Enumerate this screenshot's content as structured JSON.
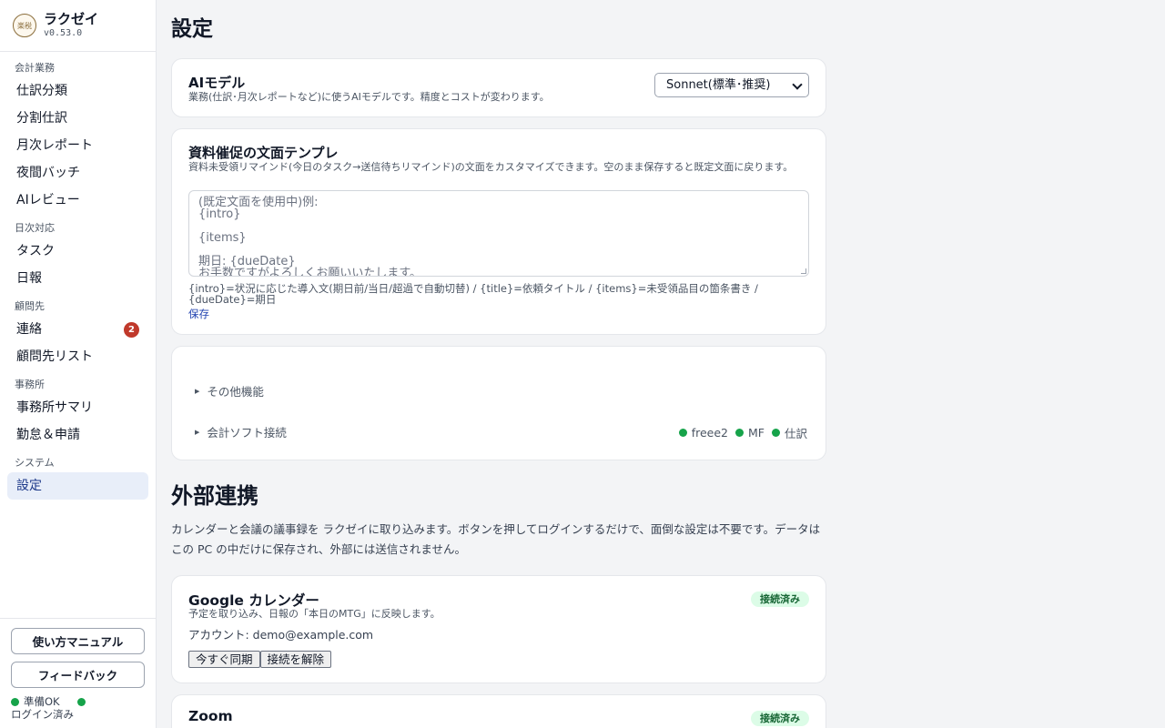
{
  "app": {
    "name": "ラクゼイ",
    "version": "v0.53.0",
    "logo_text": "楽税"
  },
  "sidebar": {
    "sections": [
      {
        "label": "会計業務",
        "items": [
          {
            "label": "仕訳分類"
          },
          {
            "label": "分割仕訳"
          },
          {
            "label": "月次レポート"
          },
          {
            "label": "夜間バッチ"
          },
          {
            "label": "AIレビュー"
          }
        ]
      },
      {
        "label": "日次対応",
        "items": [
          {
            "label": "タスク"
          },
          {
            "label": "日報"
          }
        ]
      },
      {
        "label": "顧問先",
        "items": [
          {
            "label": "連絡",
            "badge": "2"
          },
          {
            "label": "顧問先リスト"
          }
        ]
      },
      {
        "label": "事務所",
        "items": [
          {
            "label": "事務所サマリ"
          },
          {
            "label": "勤怠＆申請"
          }
        ]
      },
      {
        "label": "システム",
        "items": [
          {
            "label": "設定",
            "active": true
          }
        ]
      }
    ],
    "footer": {
      "manual_button": "使い方マニュアル",
      "feedback_button": "フィードバック",
      "status_text": "準備OK",
      "login_text": "ログイン済み"
    }
  },
  "page": {
    "title": "設定"
  },
  "ai_model": {
    "title": "AIモデル",
    "description": "業務(仕訳･月次レポートなど)に使うAIモデルです。精度とコストが変わります。",
    "selected": "Sonnet(標準･推奨)"
  },
  "template": {
    "title": "資料催促の文面テンプレ",
    "description": "資料未受領リマインド(今日のタスク→送信待ちリマインド)の文面をカスタマイズできます。空のまま保存すると既定文面に戻ります。",
    "placeholder_lines": [
      "(既定文面を使用中)例:",
      "{intro}",
      "",
      "{items}",
      "",
      "期日: {dueDate}",
      "お手数ですがよろしくお願いいたします。"
    ],
    "help": "{intro}=状況に応じた導入文(期日前/当日/超過で自動切替) / {title}=依頼タイトル / {items}=未受領品目の箇条書き / {dueDate}=期日",
    "save_label": "保存"
  },
  "misc": {
    "other_features": "その他機能",
    "accounting_software": "会計ソフト接続",
    "connections": [
      "freee2",
      "MF",
      "仕訳"
    ]
  },
  "integrations": {
    "title": "外部連携",
    "description": "カレンダーと会議の議事録を ラクゼイに取り込みます。ボタンを押してログインするだけで、面倒な設定は不要です。データはこの PC の中だけに保存され、外部には送信されません。",
    "google": {
      "title": "Google カレンダー",
      "status": "接続済み",
      "description": "予定を取り込み、日報の「本日のMTG」に反映します。",
      "account": "アカウント: demo@example.com",
      "sync_button": "今すぐ同期",
      "disconnect_button": "接続を解除"
    },
    "zoom": {
      "title": "Zoom",
      "status": "接続済み"
    }
  }
}
